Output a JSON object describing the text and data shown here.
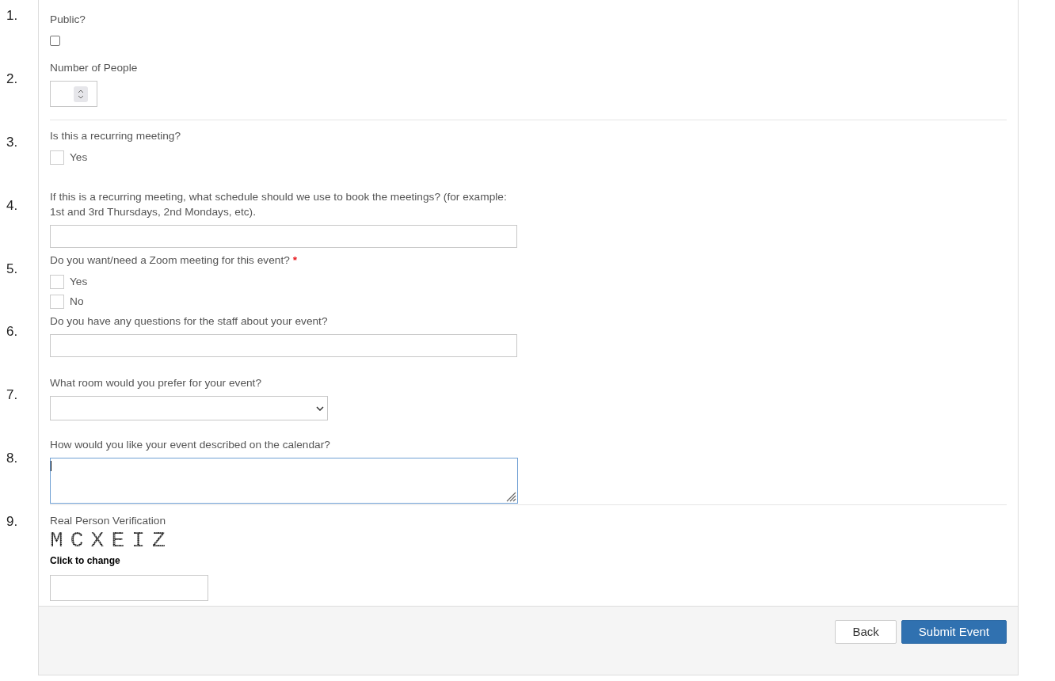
{
  "row_numbers": [
    "1.",
    "2.",
    "3.",
    "4.",
    "5.",
    "6.",
    "7.",
    "8.",
    "9."
  ],
  "sections": [
    {
      "fields": [
        {
          "kind": "checkbox",
          "label": "Public?",
          "checked": false
        },
        {
          "kind": "number",
          "label": "Number of People"
        }
      ]
    },
    {
      "fields": [
        {
          "kind": "options",
          "label": "Is this a recurring meeting?",
          "options": [
            {
              "label": "Yes",
              "checked": false
            }
          ]
        },
        {
          "kind": "text",
          "label": "If this is a recurring meeting, what schedule should we use to book the meetings? (for example: 1st and 3rd Thursdays, 2nd Mondays, etc)."
        },
        {
          "kind": "options",
          "label": "Do you want/need a Zoom meeting for this event?",
          "required_mark": "*",
          "options": [
            {
              "label": "Yes",
              "checked": false
            },
            {
              "label": "No",
              "checked": false
            }
          ]
        },
        {
          "kind": "text",
          "label": "Do you have any questions for the staff about your event?"
        },
        {
          "kind": "select",
          "label": "What room would you prefer for your event?"
        },
        {
          "kind": "textarea",
          "label": "How would you like your event described on the calendar?",
          "focused": true
        }
      ]
    },
    {
      "fields": [
        {
          "kind": "captcha",
          "label": "Real Person Verification",
          "code": "MCXEIZ",
          "hint": "Click to change"
        }
      ]
    }
  ],
  "buttons": [
    {
      "kind": "secondary",
      "label": "Back"
    },
    {
      "kind": "primary",
      "label": "Submit Event"
    }
  ]
}
